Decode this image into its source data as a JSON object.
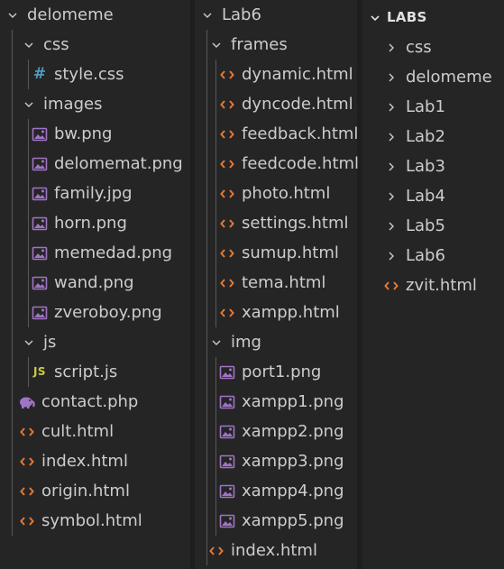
{
  "col1": {
    "root": "delomeme",
    "css_folder": "css",
    "style_css": "style.css",
    "images_folder": "images",
    "images": [
      "bw.png",
      "delomemat.png",
      "family.jpg",
      "horn.png",
      "memedad.png",
      "wand.png",
      "zveroboy.png"
    ],
    "js_folder": "js",
    "script_js": "script.js",
    "files": {
      "contact": "contact.php",
      "cult": "cult.html",
      "index": "index.html",
      "origin": "origin.html",
      "symbol": "symbol.html"
    }
  },
  "col2": {
    "root": "Lab6",
    "frames_folder": "frames",
    "frames": [
      "dynamic.html",
      "dyncode.html",
      "feedback.html",
      "feedcode.html",
      "photo.html",
      "settings.html",
      "sumup.html",
      "tema.html",
      "xampp.html"
    ],
    "img_folder": "img",
    "img": [
      "port1.png",
      "xampp1.png",
      "xampp2.png",
      "xampp3.png",
      "xampp4.png",
      "xampp5.png"
    ],
    "index": "index.html"
  },
  "col3": {
    "root": "LABS",
    "folders": [
      "css",
      "delomeme",
      "Lab1",
      "Lab2",
      "Lab3",
      "Lab4",
      "Lab5",
      "Lab6"
    ],
    "zvit": "zvit.html"
  },
  "colors": {
    "html": "#e37933",
    "image": "#a074c4",
    "css": "#519aba",
    "js": "#cbcb41",
    "php": "#a074c4"
  },
  "icons": {
    "expanded": "chevron-down-icon",
    "collapsed": "chevron-right-icon",
    "html": "html-file-icon",
    "image": "image-file-icon",
    "css": "css-file-icon",
    "js": "js-file-icon",
    "php": "php-file-icon"
  }
}
